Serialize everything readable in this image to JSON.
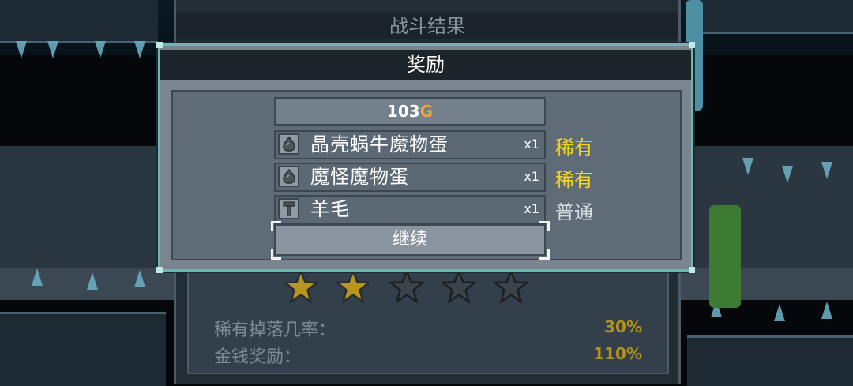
{
  "results": {
    "title": "战斗结果",
    "stars_earned": 2,
    "stars_total": 5,
    "stats": [
      {
        "label": "稀有掉落几率：",
        "value": "30%"
      },
      {
        "label": "金钱奖励：",
        "value": "110%"
      }
    ]
  },
  "reward": {
    "title": "奖励",
    "gold_amount": "103",
    "gold_unit": "G",
    "items": [
      {
        "name": "晶壳蜗牛魔物蛋",
        "quantity": "x1",
        "rarity": "稀有",
        "icon": "egg-icon"
      },
      {
        "name": "魔怪魔物蛋",
        "quantity": "x1",
        "rarity": "稀有",
        "icon": "egg-icon"
      },
      {
        "name": "羊毛",
        "quantity": "x1",
        "rarity": "普通",
        "icon": "hammer-icon"
      }
    ],
    "continue_label": "继续"
  },
  "colors": {
    "rare": "#f5d623",
    "common": "#d6dde2",
    "gold": "#f2a235",
    "star_filled": "#b8961a",
    "star_empty": "#3c444b"
  }
}
